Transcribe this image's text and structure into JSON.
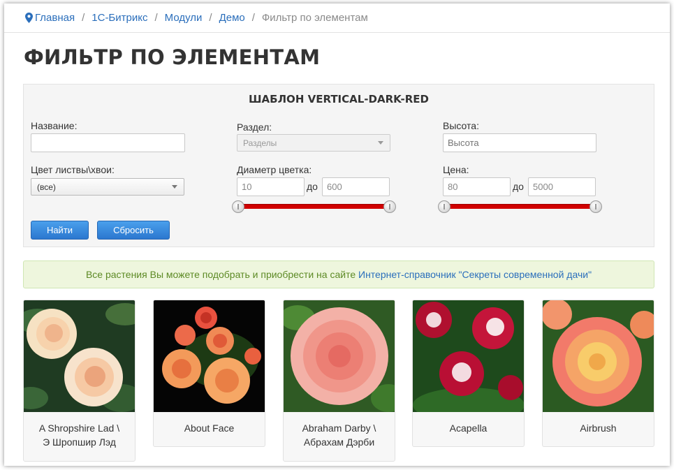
{
  "breadcrumb": {
    "items": [
      "Главная",
      "1С-Битрикс",
      "Модули",
      "Демо"
    ],
    "current": "Фильтр по элементам",
    "separator": "/"
  },
  "page_title": "ФИЛЬТР ПО ЭЛЕМЕНТАМ",
  "filter": {
    "title": "ШАБЛОН VERTICAL-DARK-RED",
    "name_label": "Название:",
    "name_value": "",
    "section_label": "Раздел:",
    "section_value": "Разделы",
    "height_label": "Высота:",
    "height_placeholder": "Высота",
    "color_label": "Цвет листвы\\хвои:",
    "color_value": "(все)",
    "diameter_label": "Диаметр цветка:",
    "diameter_from": "10",
    "diameter_to": "600",
    "price_label": "Цена:",
    "price_from": "80",
    "price_to": "5000",
    "to_label": "до",
    "slider_color": "#d10000",
    "find_button": "Найти",
    "reset_button": "Сбросить"
  },
  "notice": {
    "text": "Все растения Вы можете подобрать и приобрести на сайте ",
    "link": "Интернет-справочник \"Секреты современной дачи\""
  },
  "products": [
    {
      "line1": "A Shropshire Lad \\",
      "line2": "Э Шропшир Лэд"
    },
    {
      "line1": "About Face",
      "line2": ""
    },
    {
      "line1": "Abraham Darby \\",
      "line2": "Абрахам Дэрби"
    },
    {
      "line1": "Acapella",
      "line2": ""
    },
    {
      "line1": "Airbrush",
      "line2": ""
    }
  ]
}
